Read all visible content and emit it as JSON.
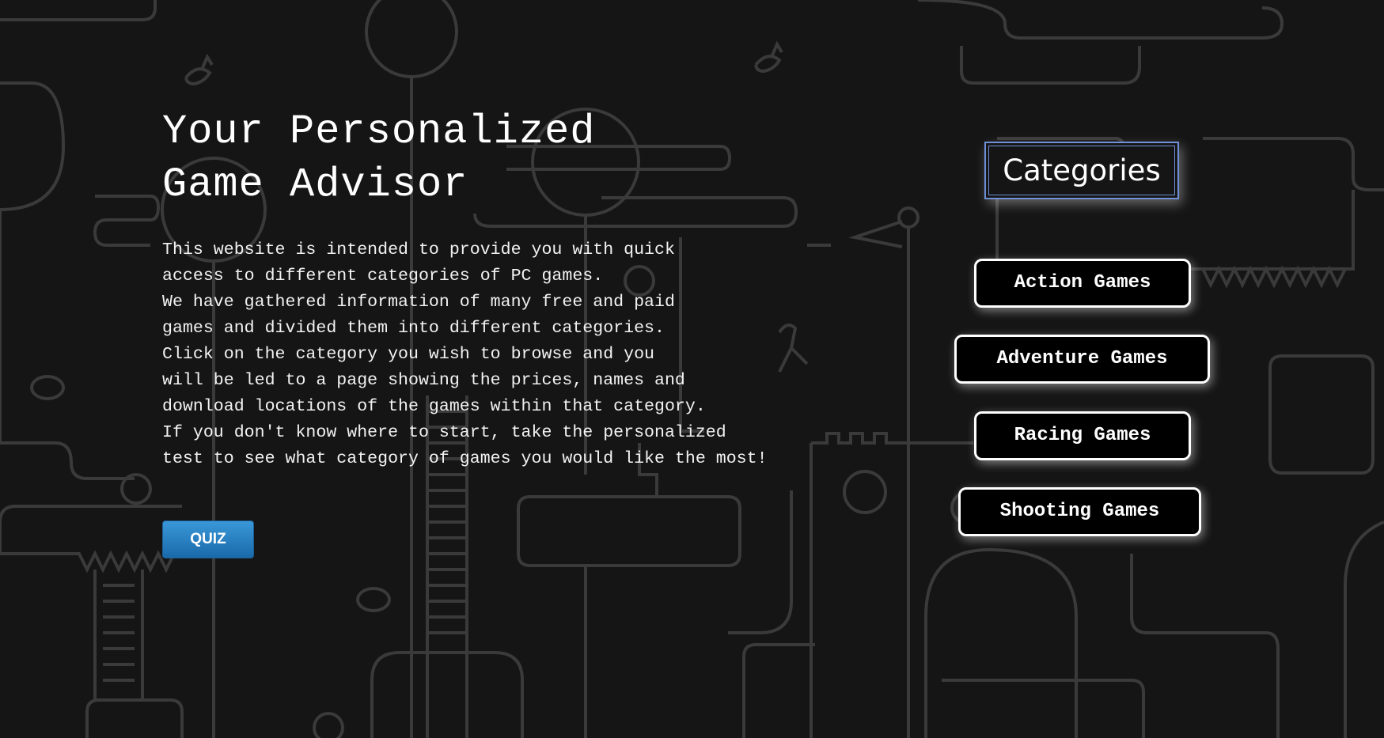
{
  "page": {
    "title_lines": [
      "Your Personalized",
      "Game Advisor"
    ],
    "description_lines": [
      "This website is intended to provide you with quick",
      "access to different categories of PC games.",
      "We have gathered information of many free and paid",
      "games and divided them into different categories.",
      "Click on the category you wish to browse and you",
      "will be led to a page showing the prices, names and",
      "download locations of the games within that category.",
      "If you don't know where to start, take the personalized",
      "test to see what category of games you would like the most!"
    ],
    "quiz_label": "QUIZ"
  },
  "categories": {
    "heading": "Categories",
    "items": [
      {
        "label": "Action Games"
      },
      {
        "label": "Adventure Games"
      },
      {
        "label": "Racing Games"
      },
      {
        "label": "Shooting Games"
      }
    ]
  },
  "colors": {
    "background": "#151515",
    "line_art": "#3a3a3a",
    "quiz_button": "#2a7fc0",
    "heading_border": "#6f8fd8",
    "text": "#ffffff"
  },
  "icons": {
    "background": "game-doodle-pattern-icon"
  }
}
